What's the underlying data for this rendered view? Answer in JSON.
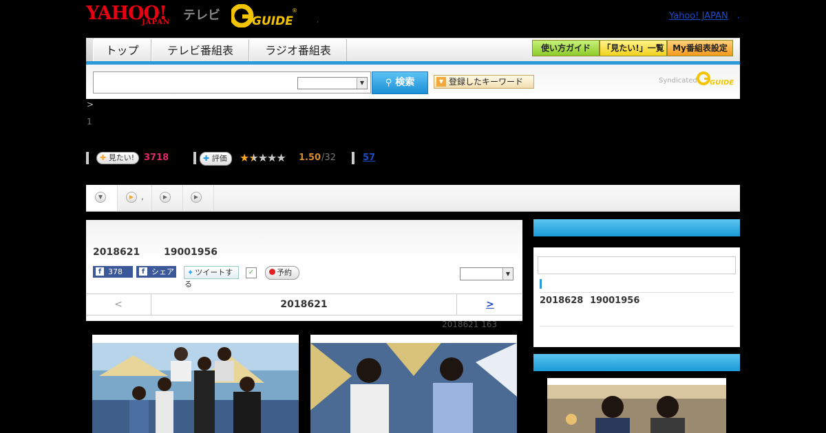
{
  "header": {
    "yahoo_logo": "YAHOO!",
    "yahoo_japan": "JAPAN",
    "tv_label": "テレビ",
    "guide_logo": "G GUIDE",
    "yahoo_japan_link": "Yahoo! JAPAN",
    "dot1": ",",
    "dot2": ","
  },
  "nav": {
    "tabs": [
      "トップ",
      "テレビ番組表",
      "ラジオ番組表"
    ],
    "buttons": [
      "使い方ガイド",
      "「見たい!」一覧",
      "My番組表設定"
    ]
  },
  "search": {
    "input_value": "",
    "select_value": "",
    "button_label": "検索",
    "keyword_button": "登録したキーワード",
    "syndicated": "Syndicated"
  },
  "breadcrumb": {
    "arrow": ">",
    "line2": "1"
  },
  "rating": {
    "mitai_label": "見たい!",
    "mitai_count": "3718",
    "hyouka_label": "評価",
    "stars_value": 1.5,
    "stars_max": 5,
    "score": "1.50",
    "score_count": "/32",
    "comments": "57"
  },
  "tabs": {
    "tab2_label": ","
  },
  "program": {
    "date": "2018621",
    "time": "19001956",
    "fb_count": "378",
    "share_label": "シェア",
    "tweet_label": "ツイートする",
    "reserve_label": "予約",
    "select_value": "",
    "prev_label": "<",
    "current_date": "2018621",
    "next_label": ">",
    "meta_text": "2018621  163"
  },
  "side": {
    "input_value": "",
    "next_date": "2018628",
    "next_time": "19001956"
  },
  "colors": {
    "accent_blue": "#2a9ad8",
    "pink": "#e0286b",
    "star": "#f5a623"
  }
}
